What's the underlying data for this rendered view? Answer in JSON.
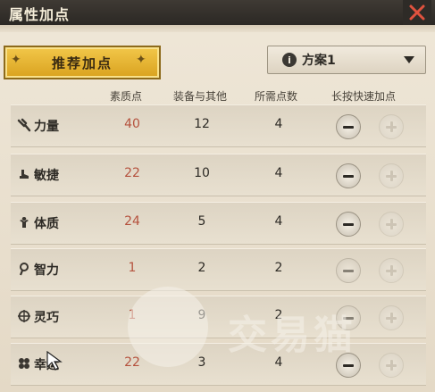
{
  "window": {
    "title": "属性加点",
    "close_icon": "close-x-icon"
  },
  "recommend_button": {
    "label": "推荐加点"
  },
  "scheme_select": {
    "icon": "info-icon",
    "selected": "方案1"
  },
  "headers": {
    "base": "素质点",
    "equip": "装备与其他",
    "need": "所需点数",
    "quick": "长按快速加点"
  },
  "attributes": [
    {
      "name": "力量",
      "icon": "strength-icon",
      "base": "40",
      "equip": "12",
      "need": "4",
      "minus_enabled": true,
      "plus_enabled": false
    },
    {
      "name": "敏捷",
      "icon": "agility-icon",
      "base": "22",
      "equip": "10",
      "need": "4",
      "minus_enabled": true,
      "plus_enabled": false
    },
    {
      "name": "体质",
      "icon": "constitution-icon",
      "base": "24",
      "equip": "5",
      "need": "4",
      "minus_enabled": true,
      "plus_enabled": false
    },
    {
      "name": "智力",
      "icon": "intelligence-icon",
      "base": "1",
      "equip": "2",
      "need": "2",
      "minus_enabled": false,
      "plus_enabled": false
    },
    {
      "name": "灵巧",
      "icon": "dexterity-icon",
      "base": "1",
      "equip": "9",
      "need": "2",
      "minus_enabled": false,
      "plus_enabled": false
    },
    {
      "name": "幸运",
      "icon": "luck-icon",
      "base": "22",
      "equip": "3",
      "need": "4",
      "minus_enabled": true,
      "plus_enabled": false
    }
  ],
  "watermark": {
    "text": "交易猫"
  },
  "colors": {
    "title_bar": "#2b2824",
    "accent_gold": "#e0ab2a",
    "base_value": "#b5523e"
  }
}
